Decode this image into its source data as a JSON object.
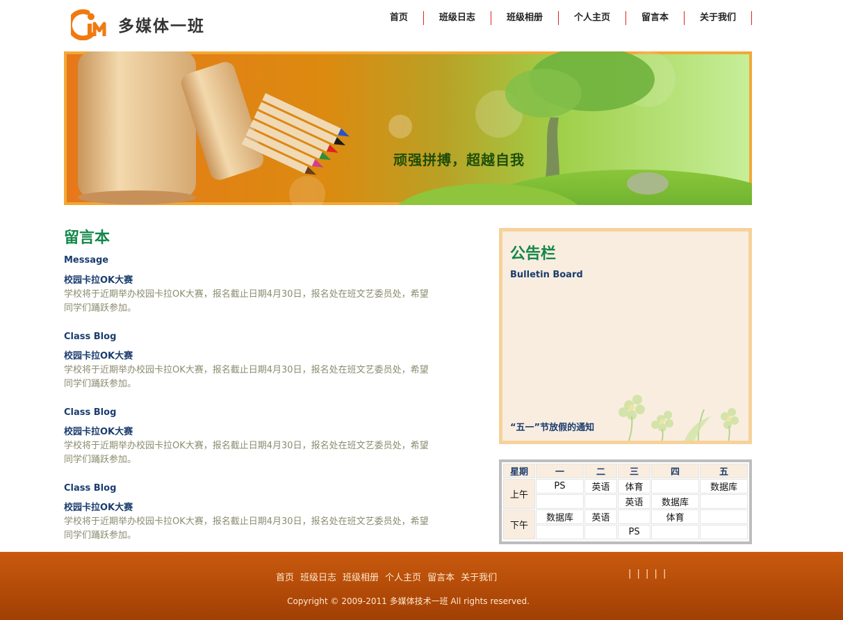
{
  "site": {
    "name": "多媒体一班"
  },
  "nav": [
    {
      "label": "首页"
    },
    {
      "label": "班级日志"
    },
    {
      "label": "班级相册"
    },
    {
      "label": "个人主页"
    },
    {
      "label": "留言本"
    },
    {
      "label": "关于我们"
    }
  ],
  "banner": {
    "slogan": "顽强拼搏，超越自我"
  },
  "guestbook": {
    "title": "留言本",
    "subtitle": "Message",
    "posts": [
      {
        "label": "",
        "title": "校园卡拉OK大赛",
        "body": "学校将于近期举办校园卡拉OK大赛，报名截止日期4月30日，报名处在班文艺委员处，希望同学们踊跃参加。"
      },
      {
        "label": "Class Blog",
        "title": "校园卡拉OK大赛",
        "body": "学校将于近期举办校园卡拉OK大赛，报名截止日期4月30日，报名处在班文艺委员处，希望同学们踊跃参加。"
      },
      {
        "label": "Class Blog",
        "title": "校园卡拉OK大赛",
        "body": "学校将于近期举办校园卡拉OK大赛，报名截止日期4月30日，报名处在班文艺委员处，希望同学们踊跃参加。"
      },
      {
        "label": "Class Blog",
        "title": "校园卡拉OK大赛",
        "body": "学校将于近期举办校园卡拉OK大赛，报名截止日期4月30日，报名处在班文艺委员处，希望同学们踊跃参加。"
      }
    ]
  },
  "bulletin": {
    "title": "公告栏",
    "subtitle": "Bulletin Board",
    "notice": "“五一”节放假的通知"
  },
  "schedule": {
    "headers": [
      "星期",
      "一",
      "二",
      "三",
      "四",
      "五"
    ],
    "morning_label": "上午",
    "afternoon_label": "下午",
    "morning": [
      [
        "PS",
        "英语",
        "体育",
        "",
        "数据库"
      ],
      [
        "",
        "",
        "英语",
        "数据库",
        ""
      ]
    ],
    "afternoon": [
      [
        "数据库",
        "英语",
        "",
        "体育",
        ""
      ],
      [
        "",
        "",
        "PS",
        "",
        ""
      ]
    ]
  },
  "footer": {
    "nav": [
      {
        "label": "首页"
      },
      {
        "label": "班级日志"
      },
      {
        "label": "班级相册"
      },
      {
        "label": "个人主页"
      },
      {
        "label": "留言本"
      },
      {
        "label": "关于我们"
      }
    ],
    "bars": "| | | | |",
    "copyright": "Copyright © 2009-2011 多媒体技术一班 All rights reserved."
  },
  "colors": {
    "accent_green": "#14874a",
    "navy": "#1a3c6e",
    "footer_orange": "#b84c09",
    "panel_border": "#f6d29a",
    "panel_bg": "#f9ede0"
  }
}
